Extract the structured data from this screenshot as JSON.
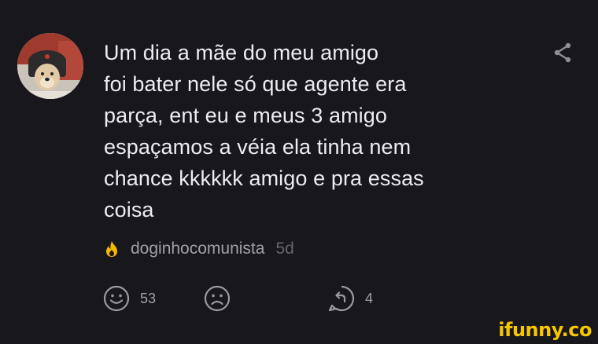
{
  "comment": {
    "lines": [
      "Um dia a mãe do meu amigo",
      "foi bater nele só que agente era",
      "parça, ent eu e meus 3 amigo",
      "espaçamos a véia ela tinha nem",
      "chance kkkkkk amigo e pra essas",
      "coisa"
    ],
    "username": "doginhocomunista",
    "timestamp": "5d",
    "badge_icon": "flame-icon",
    "avatar_icon": "dog-with-ushanka-avatar"
  },
  "actions": {
    "smile_count": "53",
    "frown_count": "",
    "reply_count": "4",
    "smile_icon": "smile-icon",
    "frown_icon": "frown-icon",
    "reply_icon": "reply-icon"
  },
  "header": {
    "share_icon": "share-icon"
  },
  "watermark": {
    "brand": "ifunny.co"
  },
  "colors": {
    "background": "#17171c",
    "text": "#ececf1",
    "secondary_text": "#a0a0a8",
    "badge": "#f5b800",
    "watermark": "#f7c600"
  }
}
